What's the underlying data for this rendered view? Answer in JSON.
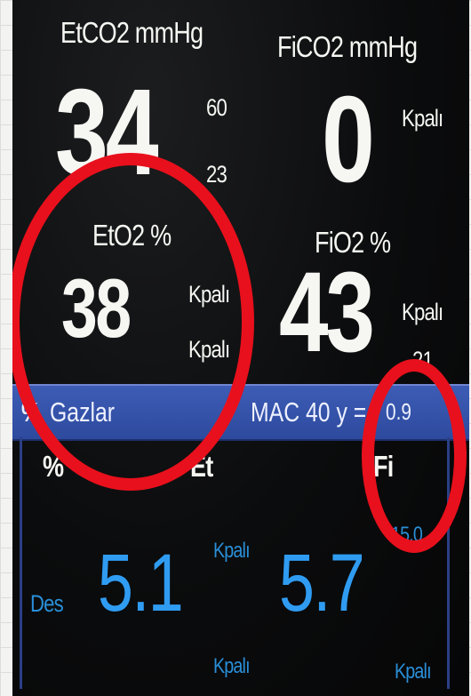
{
  "etco2": {
    "label": "EtCO2 mmHg",
    "value": "34",
    "upper": "60",
    "lower": "23"
  },
  "fico2": {
    "label": "FiCO2  mmHg",
    "value": "0",
    "unit": "Kpalı"
  },
  "eto2": {
    "label": "EtO2  %",
    "value": "38",
    "unit_top": "Kpalı",
    "unit_bottom": "Kpalı"
  },
  "fio2": {
    "label": "FiO2  %",
    "value": "43",
    "unit": "Kpalı",
    "limit": "21"
  },
  "gas_bar": {
    "icon_text": "%",
    "title": "Gazlar",
    "mac_label": "MAC 40 y =",
    "mac_value": "0.9"
  },
  "gas_table": {
    "unit_label": "%",
    "col_et": "Et",
    "col_fi": "Fi",
    "agent": "Des",
    "et_value": "5.1",
    "fi_value": "5.7",
    "kpa_top": "Kpalı",
    "kpa_bottom": "Kpalı",
    "fi_limit": "15.0",
    "kpa_right": "Kpalı"
  },
  "colors": {
    "annotation": "#e8101c",
    "gas_blue": "#2f9cf2",
    "bar": "#3d5cb5"
  }
}
